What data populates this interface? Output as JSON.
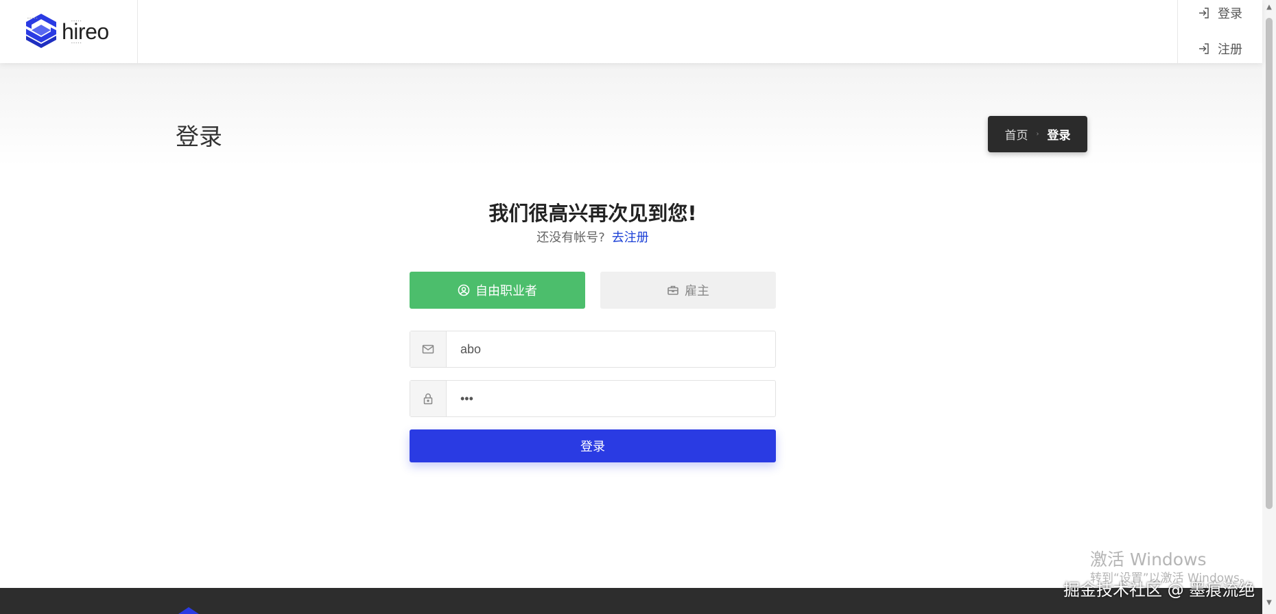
{
  "header": {
    "logo_text": "hireo",
    "auth_links": [
      {
        "label": "登录",
        "icon": "login-icon"
      },
      {
        "label": "注册",
        "icon": "login-icon"
      }
    ]
  },
  "title_band": {
    "page_title": "登录",
    "breadcrumb": {
      "home": "首页",
      "separator": "›",
      "current": "登录"
    }
  },
  "login": {
    "welcome": "我们很高兴再次见到您!",
    "no_account": "还没有帐号?",
    "register_link": "去注册",
    "roles": [
      {
        "label": "自由职业者",
        "icon": "user-circle-icon",
        "active": true
      },
      {
        "label": "雇主",
        "icon": "briefcase-icon",
        "active": false
      }
    ],
    "email": {
      "value": "abo",
      "icon": "mail-icon"
    },
    "password": {
      "value": "•••",
      "icon": "lock-icon"
    },
    "submit_label": "登录"
  },
  "watermark": {
    "line1": "激活 Windows",
    "line2": "转到“设置”以激活 Windows。"
  },
  "footer_credit": "掘金技术社区 @ 墨痕流绝",
  "colors": {
    "primary": "#2a3be3",
    "success": "#4cbe6c",
    "dark": "#2b2b2b",
    "link": "#1a3fd6"
  }
}
